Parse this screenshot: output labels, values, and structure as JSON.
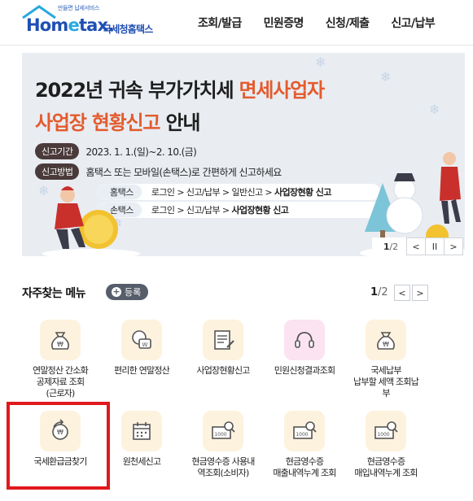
{
  "header": {
    "logo_slogan": "만들면 납세서비스",
    "logo_word_prefix": "Hom",
    "logo_word_e": "e",
    "logo_word_suffix": "tax.",
    "logo_kr": "국세청홈택스",
    "nav": [
      "조회/발급",
      "민원증명",
      "신청/제출",
      "신고/납부"
    ]
  },
  "banner": {
    "title1_a": "2022년 귀속 부가가치세 ",
    "title1_b": "면세사업자",
    "title2_a": "사업장 현황신고",
    "title2_b": " 안내",
    "period_label": "신고기간",
    "period_text": "2023. 1. 1.(일)~2. 10.(금)",
    "method_label": "신고방법",
    "method_text": "홈택스 또는 모바일(손택스)로 간편하게 신고하세요",
    "hometax_label": "홈택스",
    "hometax_path": "로그인 > 신고/납부 > 일반신고 > ",
    "hometax_path_bold": "사업장현황 신고",
    "sontax_label": "손택스",
    "sontax_path": "로그인 > 신고/납부 > ",
    "sontax_path_bold": "사업장현황 신고",
    "pager_current": "1",
    "pager_total": "/2",
    "prev": "<",
    "pause": "II",
    "next": ">"
  },
  "favorites": {
    "title": "자주찾는 메뉴",
    "add_label": "등록",
    "add_plus": "+",
    "pager_current": "1",
    "pager_total": "/2",
    "prev": "<",
    "next": ">",
    "tiles": [
      {
        "label": "연말정산 간소화\n공제자료 조회\n(근로자)"
      },
      {
        "label": "편리한 연말정산"
      },
      {
        "label": "사업장현황신고"
      },
      {
        "label": "민원신청결과조회"
      },
      {
        "label": "국세납부\n납부할 세액 조회납\n부"
      },
      {
        "label": "국세환급금찾기"
      },
      {
        "label": "원천세신고"
      },
      {
        "label": "현금영수증 사용내\n역조회(소비자)"
      },
      {
        "label": "현금영수증\n매출내역누계 조회"
      },
      {
        "label": "현금영수증\n매입내역누계 조회"
      }
    ]
  },
  "colors": {
    "accent_orange": "#e35b2e",
    "brand_blue": "#1f4fb3",
    "highlight_red": "#e0191e",
    "tile_bg": "#fdf2de"
  }
}
